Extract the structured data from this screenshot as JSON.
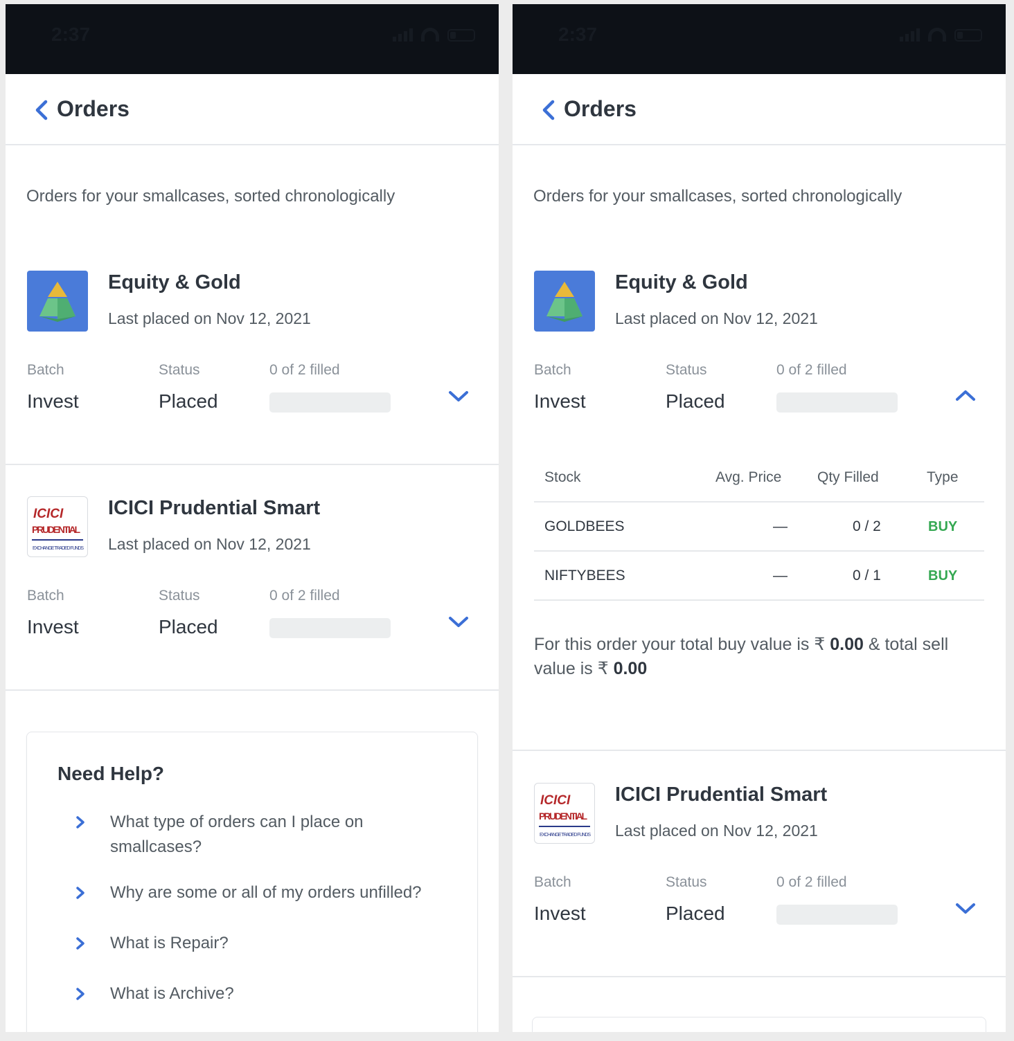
{
  "status_bar": {
    "time": "2:37"
  },
  "header": {
    "title": "Orders"
  },
  "intro": "Orders for your smallcases, sorted chronologically",
  "labels": {
    "batch": "Batch",
    "status": "Status"
  },
  "orders": [
    {
      "name": "Equity & Gold",
      "date": "Last placed on Nov 12, 2021",
      "batch": "Invest",
      "status": "Placed",
      "filled": "0 of 2 filled",
      "fill_fraction": 0
    },
    {
      "name": "ICICI Prudential Smart",
      "date": "Last placed on Nov 12, 2021",
      "batch": "Invest",
      "status": "Placed",
      "filled": "0 of 2 filled",
      "fill_fraction": 0
    }
  ],
  "icici_logo": {
    "line1": "ICICI",
    "line2": "PRUDENTIAL",
    "line3": "EXCHANGE TRADED FUNDS"
  },
  "help": {
    "title": "Need Help?",
    "items": [
      "What type of orders can I place on smallcases?",
      "Why are some or all of my orders unfilled?",
      "What is Repair?",
      "What is Archive?"
    ]
  },
  "detail_table": {
    "headers": {
      "stock": "Stock",
      "avg_price": "Avg. Price",
      "qty_filled": "Qty Filled",
      "type": "Type"
    },
    "rows": [
      {
        "stock": "GOLDBEES",
        "avg_price": "—",
        "qty_filled": "0 / 2",
        "type": "BUY"
      },
      {
        "stock": "NIFTYBEES",
        "avg_price": "—",
        "qty_filled": "0 / 1",
        "type": "BUY"
      }
    ]
  },
  "summary": {
    "prefix": "For this order your total buy value is ₹",
    "buy_value": "0.00",
    "middle": "& total sell value is ₹",
    "sell_value": "0.00"
  },
  "colors": {
    "accent": "#3b6fd6",
    "buy_green": "#35a852",
    "statusbar_bg": "#0d1117"
  }
}
